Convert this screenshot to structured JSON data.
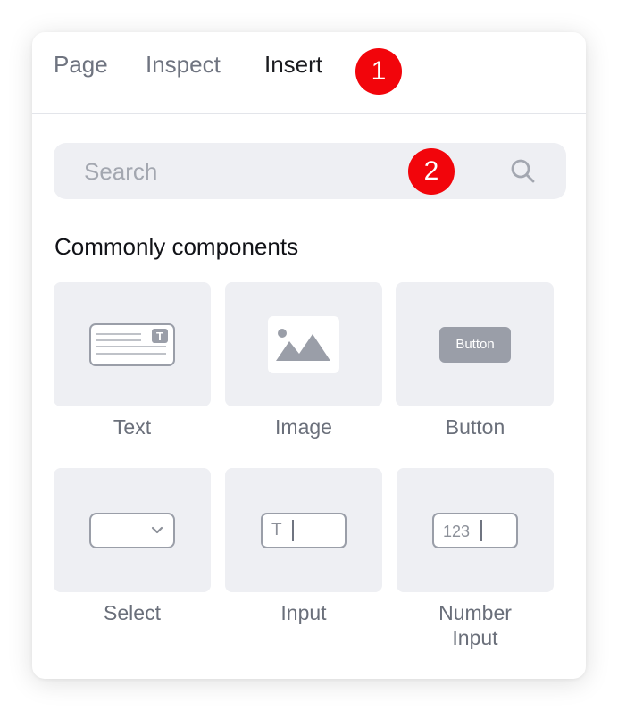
{
  "tabs": [
    {
      "label": "Page",
      "active": false
    },
    {
      "label": "Inspect",
      "active": false
    },
    {
      "label": "Insert",
      "active": true
    }
  ],
  "badges": [
    "1",
    "2"
  ],
  "search": {
    "placeholder": "Search",
    "value": ""
  },
  "section": {
    "title": "Commonly components"
  },
  "components": [
    {
      "label": "Text",
      "icon": "text-icon"
    },
    {
      "label": "Image",
      "icon": "image-icon"
    },
    {
      "label": "Button",
      "icon": "button-icon",
      "preview_text": "Button"
    },
    {
      "label": "Select",
      "icon": "select-icon"
    },
    {
      "label": "Input",
      "icon": "input-icon",
      "preview_text": "T"
    },
    {
      "label_line1": "Number",
      "label_line2": "Input",
      "icon": "number-input-icon",
      "preview_text": "123"
    }
  ],
  "colors": {
    "badge": "#f2050b",
    "tile_bg": "#eeeff3",
    "icon_gray": "#9a9ea8",
    "active_tab": "#1a1b1f",
    "inactive_tab": "#6f7480"
  }
}
